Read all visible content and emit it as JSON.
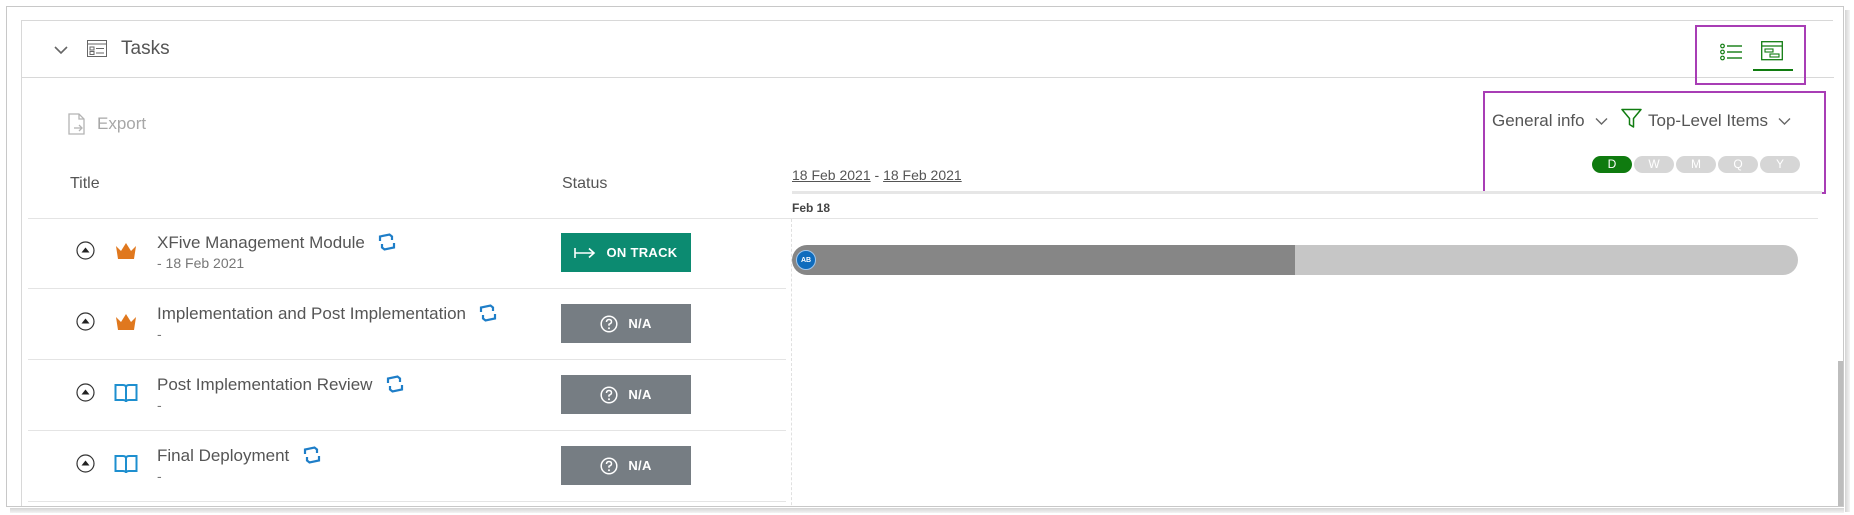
{
  "header": {
    "title": "Tasks"
  },
  "toolbar": {
    "export_label": "Export",
    "general_info_label": "General info",
    "filter_label": "Top-Level Items"
  },
  "timescale": {
    "options": [
      "D",
      "W",
      "M",
      "Q",
      "Y"
    ],
    "selected": "D"
  },
  "gantt": {
    "range_start": "18 Feb 2021",
    "range_separator": "-",
    "range_end": "18 Feb 2021",
    "day_label": "Feb 18",
    "bar_progress": 0.5,
    "avatar_initials": "AB"
  },
  "table": {
    "columns": {
      "title": "Title",
      "status": "Status"
    },
    "rows": [
      {
        "name": "XFive Management Module",
        "sub": "- 18 Feb 2021",
        "status": "ON TRACK",
        "type": "crown-icon"
      },
      {
        "name": "Implementation and Post Implementation",
        "sub": "-",
        "status": "N/A",
        "type": "crown-icon"
      },
      {
        "name": "Post Implementation Review",
        "sub": "-",
        "status": "N/A",
        "type": "book-icon"
      },
      {
        "name": "Final Deployment",
        "sub": "-",
        "status": "N/A",
        "type": "book-icon"
      }
    ]
  },
  "colors": {
    "accent_green": "#107c10",
    "on_track": "#0c8b71",
    "na": "#767d83",
    "highlight": "#a83db5",
    "crown": "#e0781e",
    "book": "#1e8fcf"
  }
}
